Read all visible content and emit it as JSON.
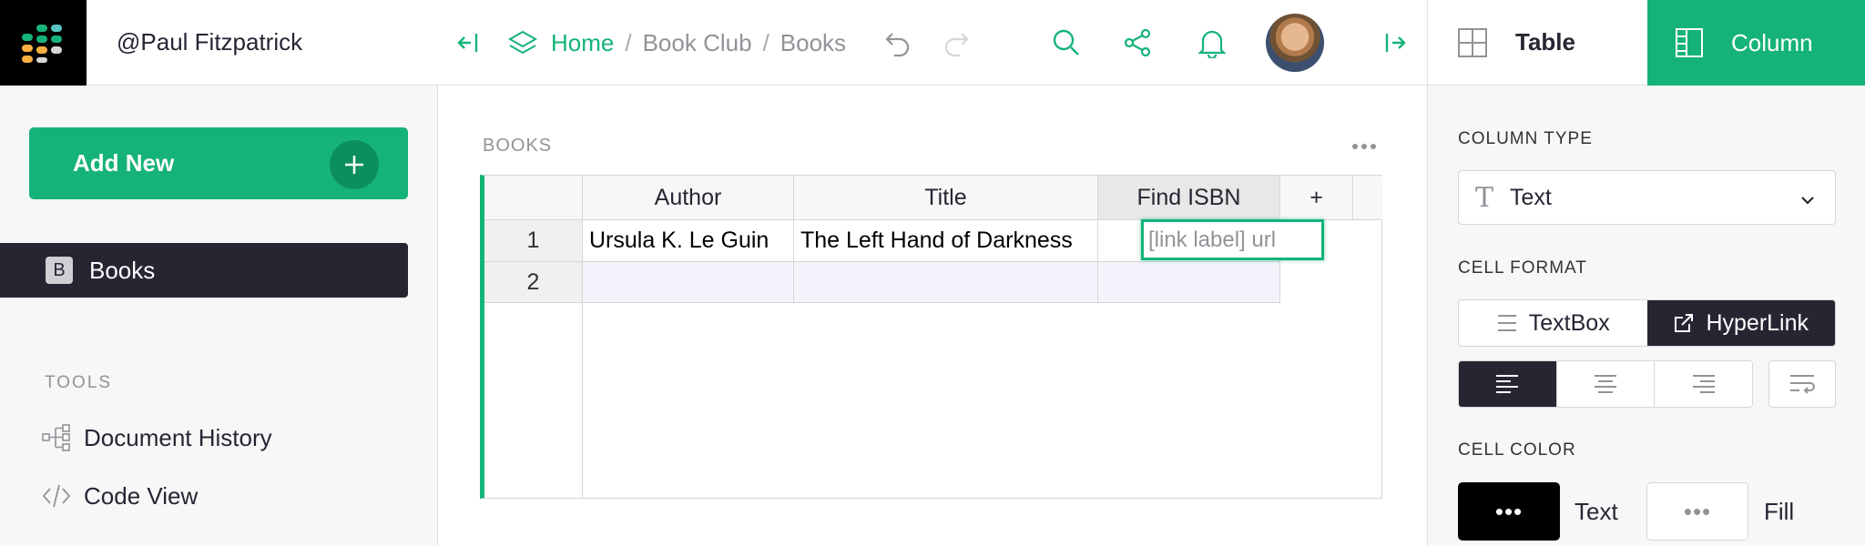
{
  "left": {
    "org_name": "@Paul Fitzpatrick",
    "add_new_label": "Add New",
    "page": {
      "badge": "B",
      "label": "Books"
    },
    "tools_header": "TOOLS",
    "tools": [
      {
        "label": "Document History",
        "icon": "document-history-icon"
      },
      {
        "label": "Code View",
        "icon": "code-icon"
      }
    ]
  },
  "topbar": {
    "breadcrumbs": [
      "Home",
      "Book Club",
      "Books"
    ],
    "separator": "/"
  },
  "section": {
    "title": "BOOKS"
  },
  "grid": {
    "columns": [
      "Author",
      "Title",
      "Find ISBN"
    ],
    "add_column_label": "+",
    "rows": [
      {
        "num": "1",
        "cells": [
          "Ursula K. Le Guin",
          "The Left Hand of Darkness",
          ""
        ]
      },
      {
        "num": "2",
        "cells": [
          "",
          "",
          ""
        ]
      }
    ],
    "active_cell_placeholder": "[link label] url"
  },
  "right": {
    "tabs": [
      {
        "label": "Table",
        "active": false
      },
      {
        "label": "Column",
        "active": true
      }
    ],
    "column_type_label": "COLUMN TYPE",
    "column_type_value": "Text",
    "column_type_icon": "T",
    "cell_format_label": "CELL FORMAT",
    "cell_format_options": [
      {
        "label": "TextBox",
        "active": false
      },
      {
        "label": "HyperLink",
        "active": true
      }
    ],
    "alignment_active": "left",
    "cell_color_label": "CELL COLOR",
    "text_color_label": "Text",
    "fill_color_label": "Fill",
    "swatch_glyph": "•••"
  },
  "colors": {
    "accent": "#16b378",
    "dark": "#262633",
    "muted": "#929299"
  }
}
